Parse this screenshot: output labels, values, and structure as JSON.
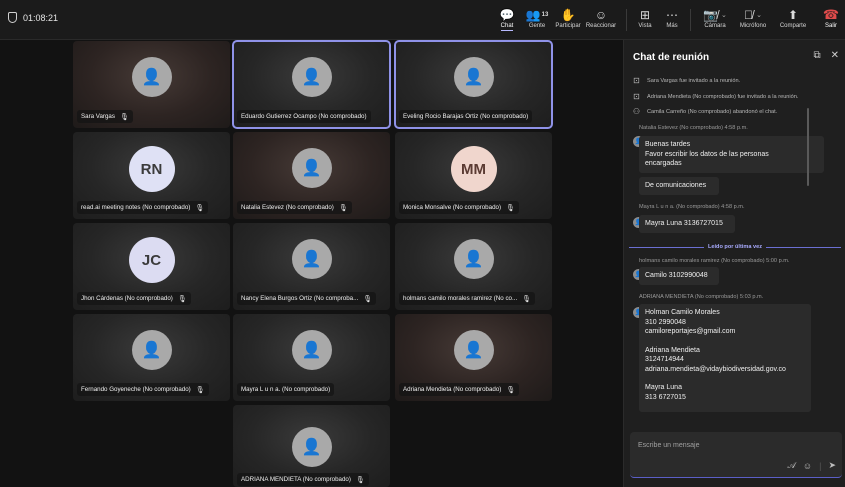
{
  "meeting": {
    "timer": "01:08:21"
  },
  "toolbar": {
    "chat": "Chat",
    "people": "Gente",
    "people_count": "13",
    "raise": "Participar",
    "react": "Reaccionar",
    "view": "Vista",
    "more": "Más",
    "camera": "Cámara",
    "mic": "Micrófono",
    "share": "Comparte",
    "leave": "Salir"
  },
  "tiles": [
    {
      "name": "Sara Vargas",
      "initials": "",
      "muted": true
    },
    {
      "name": "Eduardo Gutierrez Ocampo (No comprobado)",
      "initials": "",
      "muted": false
    },
    {
      "name": "Eveling Rocio Barajas Ortiz (No comprobado)",
      "initials": "",
      "muted": false
    },
    {
      "name": "read.ai meeting notes (No comprobado)",
      "initials": "RN",
      "muted": true
    },
    {
      "name": "Natalia Estevez (No comprobado)",
      "initials": "",
      "muted": true
    },
    {
      "name": "Monica Monsalve (No comprobado)",
      "initials": "MM",
      "muted": true
    },
    {
      "name": "Jhon Cárdenas (No comprobado)",
      "initials": "JC",
      "muted": true
    },
    {
      "name": "Nancy Elena Burgos Ortiz (No comproba...",
      "initials": "",
      "muted": true
    },
    {
      "name": "holmans camilo morales ramirez (No co...",
      "initials": "",
      "muted": true
    },
    {
      "name": "Fernando Goyeneche (No comprobado)",
      "initials": "",
      "muted": true
    },
    {
      "name": "Mayra L u n a. (No comprobado)",
      "initials": "",
      "muted": false
    },
    {
      "name": "Adriana Mendieta (No comprobado)",
      "initials": "",
      "muted": true
    },
    {
      "name": "ADRIANA MENDIETA (No comprobado)",
      "initials": "",
      "muted": true
    }
  ],
  "chat": {
    "title": "Chat de reunión",
    "system": [
      "Sara Vargas fue invitado a la reunión.",
      "Adriana Mendieta (No comprobado) fue invitado a la reunión.",
      "Camila Carreño (No comprobado) abandonó el chat."
    ],
    "messages": [
      {
        "meta": "Natalia Estevez (No comprobado)   4:58 p.m.",
        "lines": [
          "Buenas tardes",
          "Favor escribir los datos de las personas",
          "encargadas"
        ]
      },
      {
        "meta": "",
        "lines": [
          "De comunicaciones"
        ]
      },
      {
        "meta": "Mayra L u n a. (No comprobado)   4:58 p.m.",
        "lines": [
          "Mayra Luna 3136727015"
        ]
      },
      {
        "meta": "holmans camilo morales ramirez (No comprobado)   5:00 p.m.",
        "lines": [
          "Camilo 3102990048"
        ]
      },
      {
        "meta": "ADRIANA MENDIETA (No comprobado)   5:03 p.m.",
        "lines": [
          "Holman Camilo Morales",
          " 310 2990048",
          "camiloreportajes@gmail.com",
          "",
          "Adriana Mendieta",
          "3124714944",
          "adriana.mendieta@vidaybiodiversidad.gov.co",
          "",
          "Mayra Luna",
          "313 6727015"
        ]
      }
    ],
    "read_marker": "Leído por última vez",
    "composer_placeholder": "Escribe un mensaje"
  }
}
